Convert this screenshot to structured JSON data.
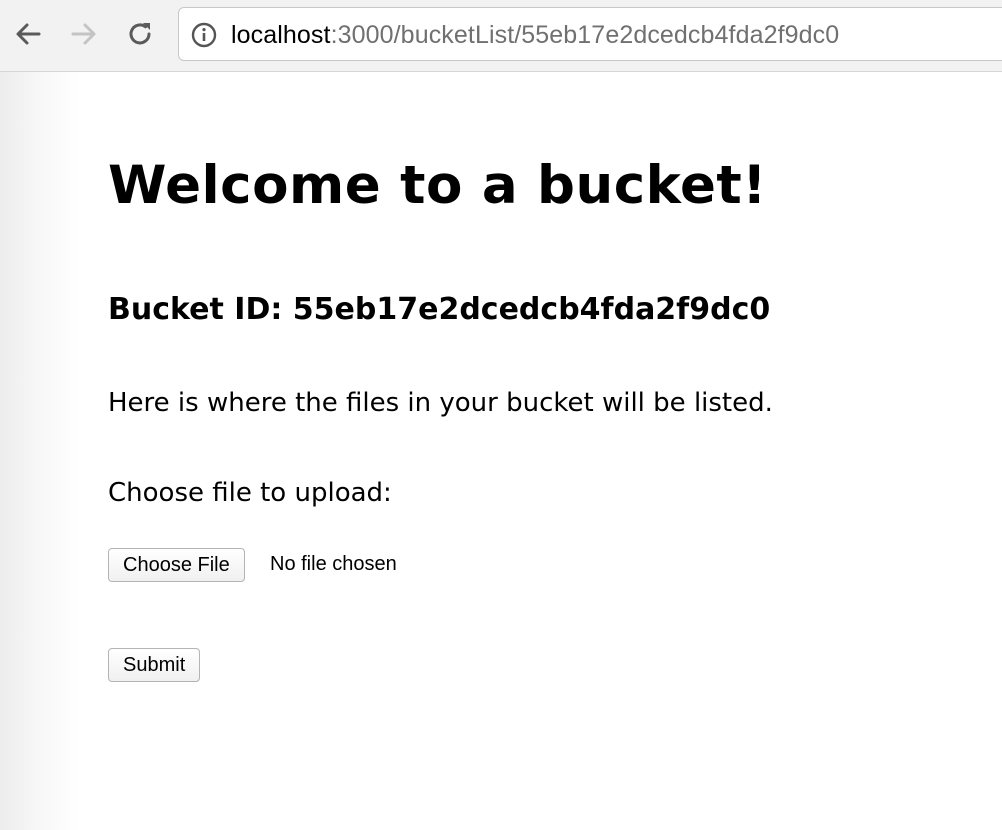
{
  "browser": {
    "url_host": "localhost",
    "url_rest": ":3000/bucketList/55eb17e2dcedcb4fda2f9dc0",
    "back_icon": "arrow-left",
    "forward_icon": "arrow-right",
    "reload_icon": "reload",
    "info_icon": "info-circle"
  },
  "page": {
    "title": "Welcome to a bucket!",
    "bucket_id_label": "Bucket ID: 55eb17e2dcedcb4fda2f9dc0",
    "description": "Here is where the files in your bucket will be listed.",
    "upload_label": "Choose file to upload:",
    "choose_file_button": "Choose File",
    "no_file_text": "No file chosen",
    "submit_button": "Submit"
  }
}
